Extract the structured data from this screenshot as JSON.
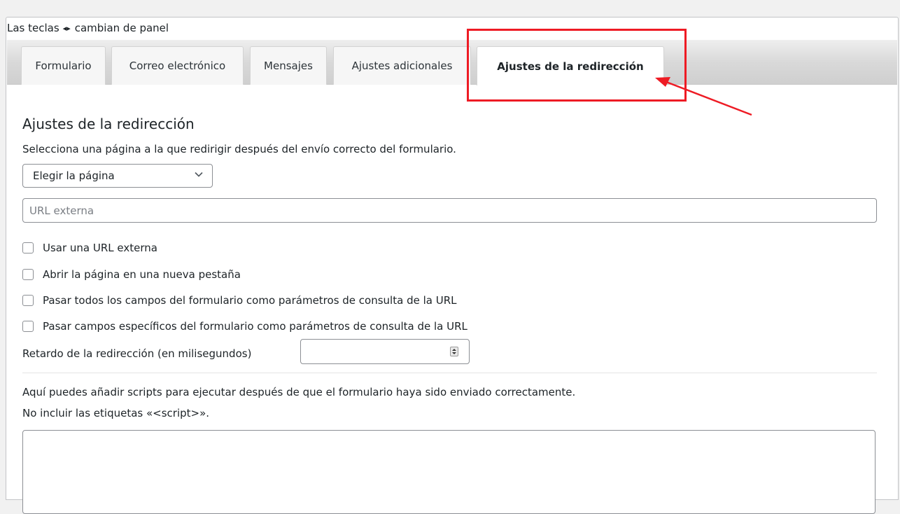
{
  "hint": {
    "before": "Las teclas",
    "arrows": "◂▸",
    "after": "cambian de panel"
  },
  "tabs": [
    {
      "label": "Formulario",
      "active": false
    },
    {
      "label": "Correo electrónico",
      "active": false
    },
    {
      "label": "Mensajes",
      "active": false
    },
    {
      "label": "Ajustes adicionales",
      "active": false
    },
    {
      "label": "Ajustes de la redirección",
      "active": true
    }
  ],
  "section": {
    "title": "Ajustes de la redirección",
    "description": "Selecciona una página a la que redirigir después del envío correcto del formulario.",
    "page_select": {
      "value": "Elegir la página"
    },
    "external_url": {
      "value": "",
      "placeholder": "URL externa"
    },
    "options": [
      {
        "label": "Usar una URL externa",
        "checked": false
      },
      {
        "label": "Abrir la página en una nueva pestaña",
        "checked": false
      },
      {
        "label": "Pasar todos los campos del formulario como parámetros de consulta de la URL",
        "checked": false
      },
      {
        "label": "Pasar campos específicos del formulario como parámetros de consulta de la URL",
        "checked": false
      }
    ],
    "delay": {
      "label": "Retardo de la redirección (en milisegundos)",
      "value": ""
    },
    "scripts": {
      "line1": "Aquí puedes añadir scripts para ejecutar después de que el formulario haya sido enviado correctamente.",
      "line2": "No incluir las etiquetas «<script>».",
      "value": ""
    }
  },
  "annotation": {
    "color": "#ee1b24"
  }
}
